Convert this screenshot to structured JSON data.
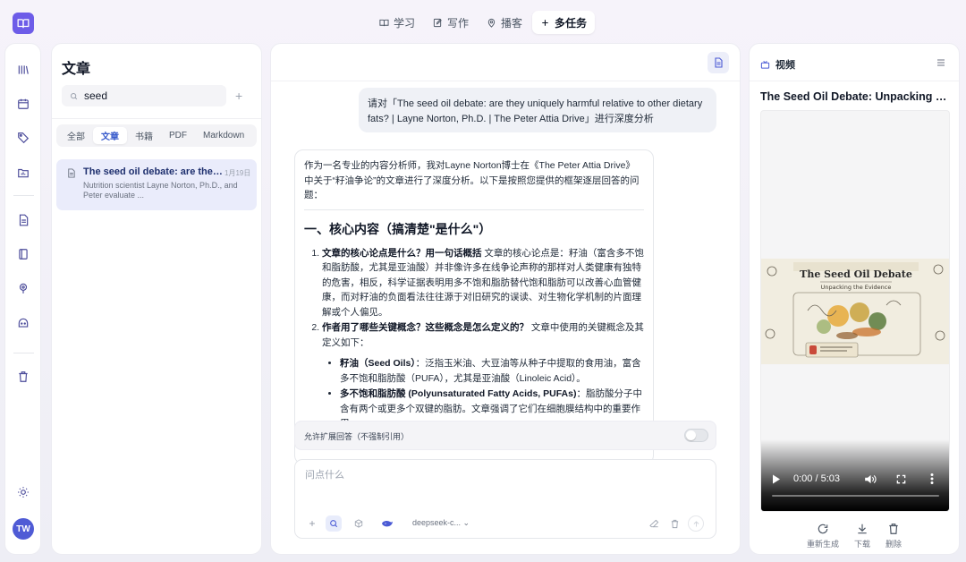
{
  "topnav": {
    "tabs": [
      {
        "label": "学习"
      },
      {
        "label": "写作"
      },
      {
        "label": "播客"
      },
      {
        "label": "多任务"
      }
    ]
  },
  "user": {
    "initials": "TW"
  },
  "left": {
    "title": "文章",
    "search": {
      "value": "seed"
    },
    "filters": [
      "全部",
      "文章",
      "书籍",
      "PDF",
      "Markdown"
    ],
    "article": {
      "title": "The seed oil debate: are they uniquely harmful relative to other dietary fats? | Layne Norton, Ph.D. | The Peter Attia Drive",
      "date": "1月19日",
      "snippet": "Nutrition scientist Layne Norton, Ph.D., and Peter evaluate ..."
    }
  },
  "chat": {
    "user_message": "请对「The seed oil debate: are they uniquely harmful relative to other dietary fats? | Layne Norton, Ph.D. | The Peter Attia Drive」进行深度分析",
    "answer": {
      "intro": "作为一名专业的内容分析师，我对Layne Norton博士在《The Peter Attia Drive》中关于“籽油争论”的文章进行了深度分析。以下是按照您提供的框架逐层回答的问题：",
      "heading": "一、核心内容（搞清楚\"是什么\"）",
      "items": [
        {
          "q": "文章的核心论点是什么？用一句话概括",
          "a": " 文章的核心论点是：籽油（富含多不饱和脂肪酸，尤其是亚油酸）并非像许多在线争论声称的那样对人类健康有独特的危害，相反，科学证据表明用多不饱和脂肪替代饱和脂肪可以改善心血管健康，而对籽油的负面看法往往源于对旧研究的误读、对生物化学机制的片面理解或个人偏见。"
        },
        {
          "q": "作者用了哪些关键概念？这些概念是怎么定义的？",
          "a": " 文章中使用的关键概念及其定义如下："
        }
      ],
      "concepts": [
        {
          "term": "籽油（Seed Oils）",
          "def": "：泛指玉米油、大豆油等从种子中提取的食用油，富含多不饱和脂肪酸（PUFA），尤其是亚油酸（Linoleic Acid）。"
        },
        {
          "term": "多不饱和脂肪酸 (Polyunsaturated Fatty Acids, PUFAs)",
          "def": "：脂肪酸分子中含有两个或更多个双键的脂肪。文章强调了它们在细胞膜结构中的重要作用。"
        }
      ]
    },
    "toggle_label": "允许扩展回答（不强制引用）",
    "input_placeholder": "问点什么",
    "model": "deepseek-c..."
  },
  "video_panel": {
    "header": "视频",
    "title": "The Seed Oil Debate: Unpacking the Evidence",
    "thumb_title": "The Seed Oil Debate",
    "thumb_subtitle": "Unpacking the Evidence",
    "time": "0:00 / 5:03",
    "progress": 0,
    "actions": [
      "重新生成",
      "下载",
      "删除"
    ]
  },
  "colors": {
    "accent": "#6d5ce8",
    "link_blue": "#3a5ccc",
    "avatar": "#4f5bd5"
  }
}
